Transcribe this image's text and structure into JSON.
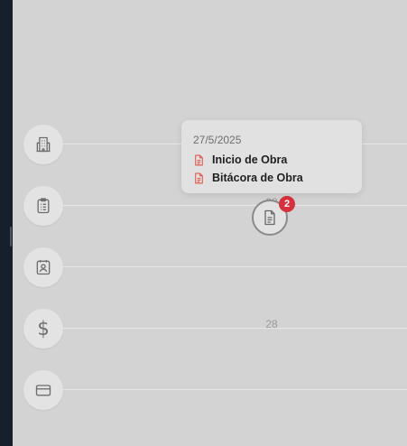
{
  "categories": [
    {
      "icon": "building-icon"
    },
    {
      "icon": "clipboard-icon"
    },
    {
      "icon": "contact-card-icon"
    },
    {
      "icon": "dollar-icon",
      "glyph": "$"
    },
    {
      "icon": "credit-card-icon"
    }
  ],
  "timeline": {
    "upper_date": "28",
    "lower_date": "28",
    "marker_icon": "document-icon",
    "marker_badge": "2"
  },
  "tooltip": {
    "date": "27/5/2025",
    "items": [
      {
        "icon": "document-icon",
        "label": "Inicio de Obra"
      },
      {
        "icon": "document-icon",
        "label": "Bitácora de Obra"
      }
    ]
  },
  "colors": {
    "sidebar": "#161f2c",
    "background": "#d3d3d3",
    "badge": "#d6323e",
    "document_icon_accent": "#e05a4c"
  }
}
